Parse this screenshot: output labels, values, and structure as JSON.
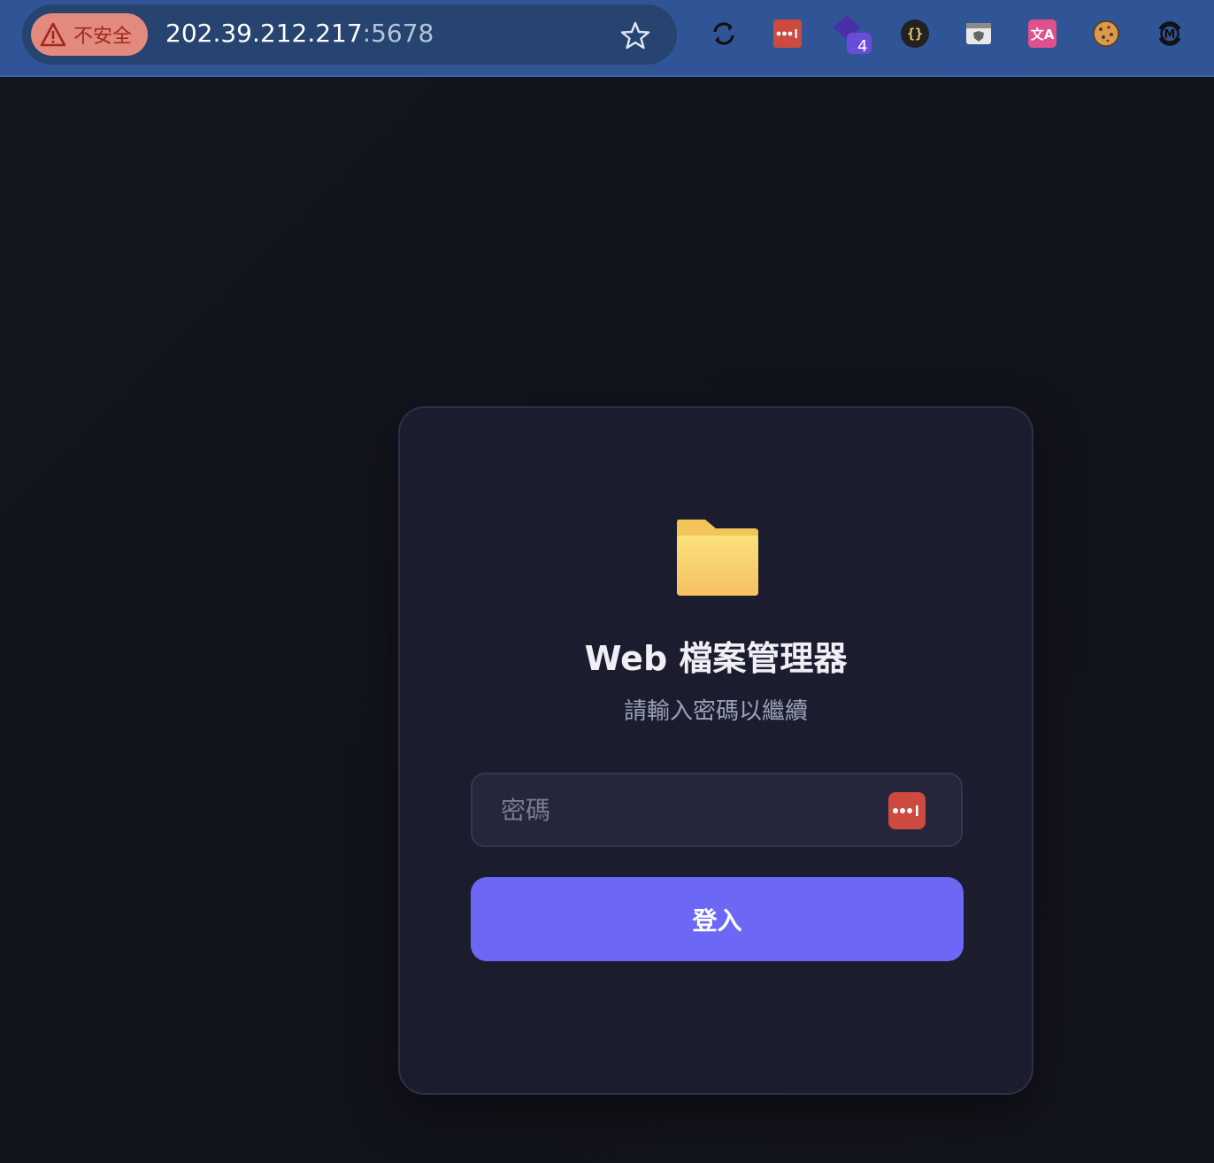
{
  "browser": {
    "security_label": "不安全",
    "url_host": "202.39.212.217",
    "url_port": ":5678",
    "extensions": [
      {
        "name": "sync-icon"
      },
      {
        "name": "password-manager-icon"
      },
      {
        "name": "purple-diamond-extension-icon",
        "badge": "4"
      },
      {
        "name": "json-braces-icon"
      },
      {
        "name": "shield-extension-icon"
      },
      {
        "name": "translate-icon"
      },
      {
        "name": "cookie-icon"
      },
      {
        "name": "m-sync-icon"
      }
    ]
  },
  "login": {
    "title": "Web 檔案管理器",
    "subtitle": "請輸入密碼以繼續",
    "password_placeholder": "密碼",
    "password_value": "",
    "submit_label": "登入"
  },
  "colors": {
    "browser_bar": "#2f5596",
    "page_bg": "#12141c",
    "card_bg": "#1b1d2e",
    "accent": "#6c68f5",
    "warning": "#e28a7e"
  }
}
